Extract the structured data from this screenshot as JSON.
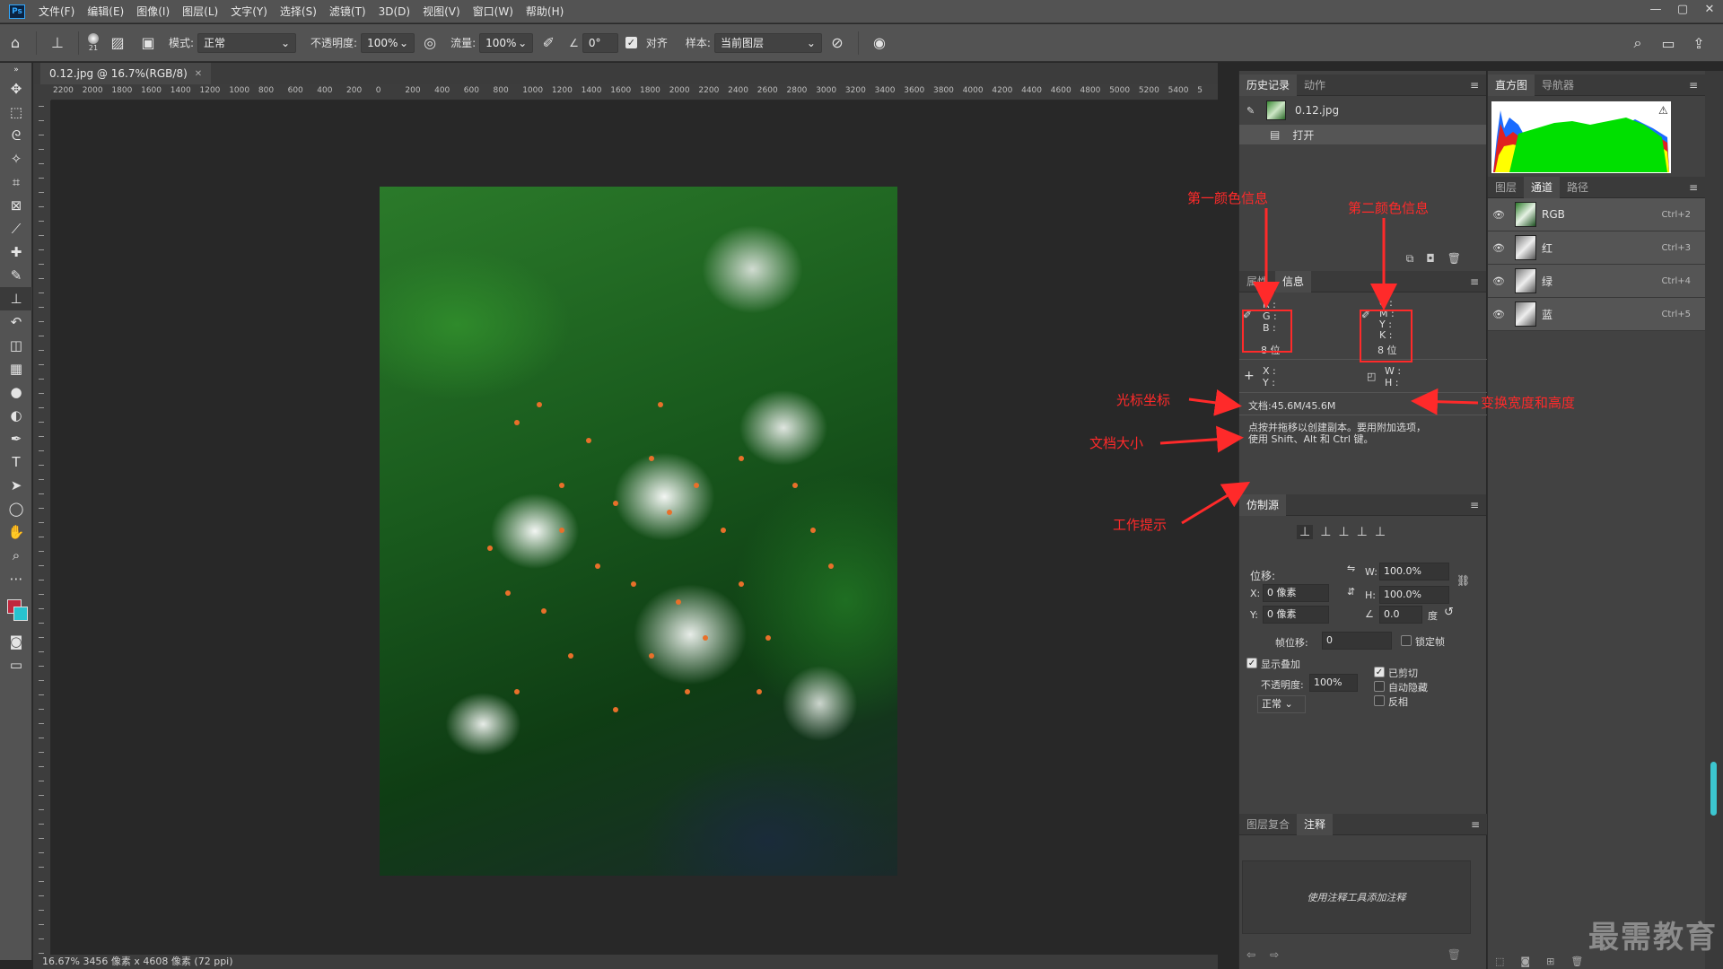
{
  "app": {
    "logo": "Ps"
  },
  "menu": [
    "文件(F)",
    "编辑(E)",
    "图像(I)",
    "图层(L)",
    "文字(Y)",
    "选择(S)",
    "滤镜(T)",
    "3D(D)",
    "视图(V)",
    "窗口(W)",
    "帮助(H)"
  ],
  "window_controls": [
    "—",
    "▢",
    "✕"
  ],
  "options": {
    "brush_size": "21",
    "mode_label": "模式:",
    "mode_value": "正常",
    "opacity_label": "不透明度:",
    "opacity_value": "100%",
    "flow_label": "流量:",
    "flow_value": "100%",
    "angle_value": "0°",
    "align_label": "对齐",
    "sample_label": "样本:",
    "sample_value": "当前图层"
  },
  "document": {
    "tab_title": "0.12.jpg @ 16.7%(RGB/8)",
    "ruler_ticks": [
      "2200",
      "2000",
      "1800",
      "1600",
      "1400",
      "1200",
      "1000",
      "800",
      "600",
      "400",
      "200",
      "0",
      "200",
      "400",
      "600",
      "800",
      "1000",
      "1200",
      "1400",
      "1600",
      "1800",
      "2000",
      "2200",
      "2400",
      "2600",
      "2800",
      "3000",
      "3200",
      "3400",
      "3600",
      "3800",
      "4000",
      "4200",
      "4400",
      "4600",
      "4800",
      "5000",
      "5200",
      "5400",
      "5"
    ],
    "status": "16.67%   3456 像素 x 4608 像素 (72 ppi)"
  },
  "annotations": {
    "first_color": "第一颜色信息",
    "second_color": "第二颜色信息",
    "cursor_coords": "光标坐标",
    "transform_size": "变换宽度和高度",
    "doc_size": "文档大小",
    "work_hint": "工作提示"
  },
  "history_panel": {
    "tabs": [
      "历史记录",
      "动作"
    ],
    "snapshot": "0.12.jpg",
    "step": "打开"
  },
  "info_panel": {
    "tabs": [
      "属性",
      "信息"
    ],
    "rgb": [
      "R :",
      "G :",
      "B :"
    ],
    "cmyk": [
      "C :",
      "M :",
      "Y :",
      "K :"
    ],
    "bit1": "8 位",
    "bit2": "8 位",
    "xy": [
      "X :",
      "Y :"
    ],
    "wh": [
      "W :",
      "H :"
    ],
    "doc": "文档:45.6M/45.6M",
    "hint_line1": "点按并拖移以创建副本。要用附加选项，",
    "hint_line2": "使用 Shift、Alt 和 Ctrl 键。"
  },
  "clone_panel": {
    "title": "仿制源",
    "offset_label": "位移:",
    "w_label": "W:",
    "w_value": "100.0%",
    "h_label": "H:",
    "h_value": "100.0%",
    "x_label": "X:",
    "x_value": "0 像素",
    "y_label": "Y:",
    "y_value": "0 像素",
    "angle_value": "0.0",
    "angle_unit": "度",
    "frame_offset_label": "帧位移:",
    "frame_offset_value": "0",
    "lock_frame": "锁定帧",
    "show_overlay": "显示叠加",
    "opacity_label": "不透明度:",
    "opacity_value": "100%",
    "clipped": "已剪切",
    "auto_hide": "自动隐藏",
    "invert": "反相",
    "blend_mode": "正常"
  },
  "notes_panel": {
    "tabs": [
      "图层复合",
      "注释"
    ],
    "placeholder": "使用注释工具添加注释"
  },
  "histogram_panel": {
    "tabs": [
      "直方图",
      "导航器"
    ]
  },
  "channels_panel": {
    "tabs": [
      "图层",
      "通道",
      "路径"
    ],
    "channels": [
      {
        "name": "RGB",
        "shortcut": "Ctrl+2"
      },
      {
        "name": "红",
        "shortcut": "Ctrl+3"
      },
      {
        "name": "绿",
        "shortcut": "Ctrl+4"
      },
      {
        "name": "蓝",
        "shortcut": "Ctrl+5"
      }
    ]
  },
  "watermark": "最需教育",
  "colors": {
    "accent": "#31a8ff",
    "annotation": "#ff2a2a",
    "foreground": "#c0283e",
    "background": "#27c3cf"
  }
}
